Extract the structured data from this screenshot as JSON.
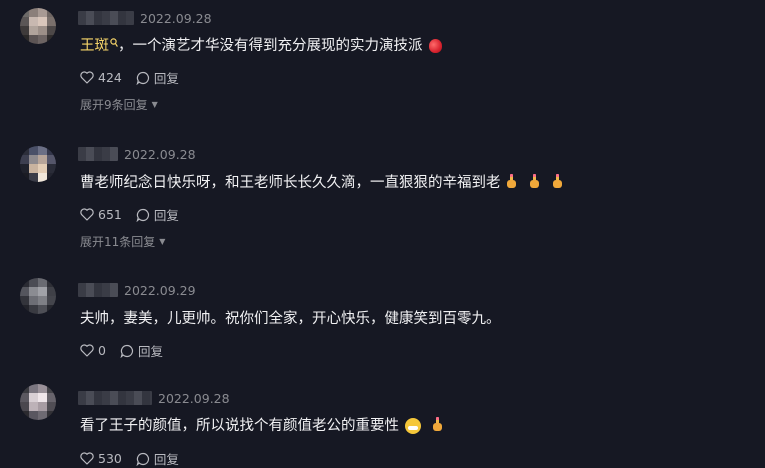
{
  "comments": [
    {
      "date": "2022.09.28",
      "mention": "王斑",
      "text": "，一个演艺才华没有得到充分展现的实力演技派",
      "likes": "424",
      "reply_label": "回复",
      "expand": "展开9条回复"
    },
    {
      "date": "2022.09.28",
      "text": "曹老师纪念日快乐呀，和王老师长长久久滴，一直狠狠的辛福到老",
      "likes": "651",
      "reply_label": "回复",
      "expand": "展开11条回复"
    },
    {
      "date": "2022.09.29",
      "text": "夫帅，妻美，儿更帅。祝你们全家，开心快乐，健康笑到百零九。",
      "likes": "0",
      "reply_label": "回复"
    },
    {
      "date": "2022.09.28",
      "text": "看了王子的颜值，所以说找个有颜值老公的重要性",
      "likes": "530",
      "reply_label": "回复"
    }
  ],
  "icons": {
    "like": "heart-icon",
    "reply": "comment-bubble-icon",
    "mention": "search-icon",
    "caret": "chevron-down-icon"
  },
  "colors": {
    "background": "#161823",
    "mention": "#f7d56a",
    "text": "#f1f1f3",
    "muted": "#8a8b91"
  }
}
